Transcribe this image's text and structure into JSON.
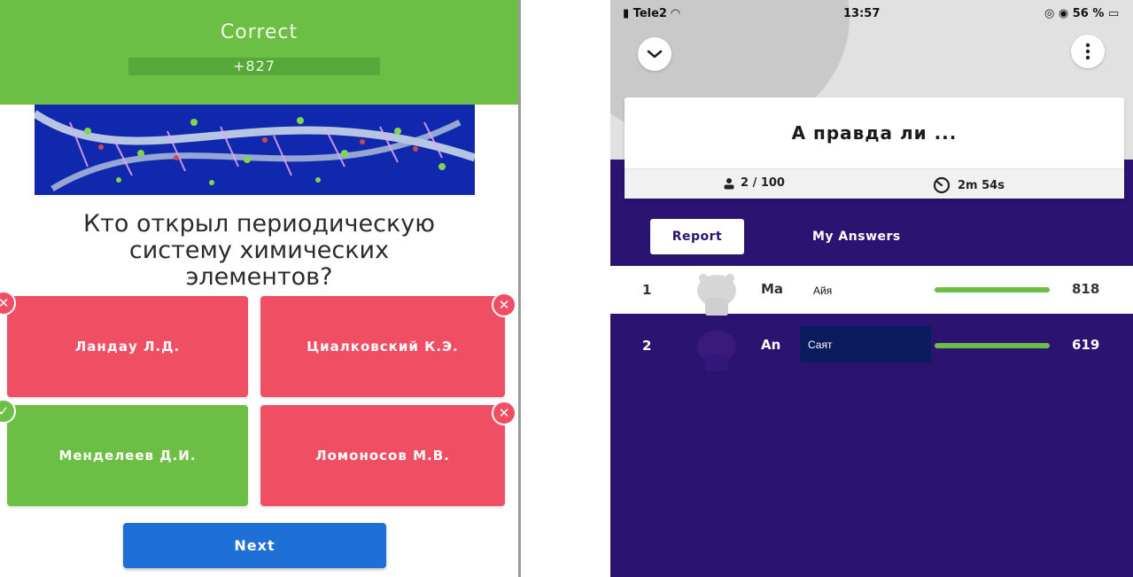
{
  "quiz_screen": {
    "result": {
      "title": "Correct",
      "points": "+827"
    },
    "question": "Кто открыл периодическую систему химических элементов?",
    "answers": [
      {
        "label": "Ландау Л.Д.",
        "status": "wrong"
      },
      {
        "label": "Циалковский К.Э.",
        "status": "wrong"
      },
      {
        "label": "Менделеев Д.И.",
        "status": "correct"
      },
      {
        "label": "Ломоносов М.В.",
        "status": "wrong"
      }
    ],
    "next_label": "Next",
    "colors": {
      "correct": "#6dbe45",
      "wrong": "#f04e63",
      "next": "#1e6fd6"
    }
  },
  "leaderboard_screen": {
    "status_bar": {
      "carrier": "Tele2",
      "time": "13:57",
      "battery": "56 %"
    },
    "quiz_title": "А правда ли ...",
    "players": "2 / 100",
    "time_left": "2m 54s",
    "tabs": {
      "report": "Report",
      "my_answers": "My Answers"
    },
    "rows": [
      {
        "rank": "1",
        "name": "Ma",
        "label": "Айя",
        "score": "818"
      },
      {
        "rank": "2",
        "name": "An",
        "label": "Саят",
        "score": "619"
      }
    ],
    "colors": {
      "background": "#2a1371",
      "bar": "#6dbe45"
    }
  }
}
